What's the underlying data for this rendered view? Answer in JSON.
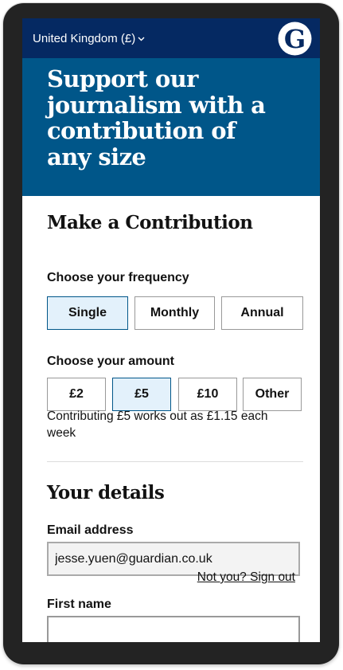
{
  "header": {
    "region_label": "United Kingdom (£)",
    "logo_letter": "G",
    "brand_color": "#052962"
  },
  "hero": {
    "title": "Support our journalism with a contribution of any size",
    "background": "#005689"
  },
  "contribution": {
    "heading": "Make a Contribution",
    "frequency": {
      "label": "Choose your frequency",
      "options": [
        "Single",
        "Monthly",
        "Annual"
      ],
      "selected": "Single"
    },
    "amount": {
      "label": "Choose your amount",
      "options": [
        "£2",
        "£5",
        "£10",
        "Other"
      ],
      "selected": "£5"
    },
    "summary": "Contributing £5 works out as £1.15 each week"
  },
  "details": {
    "heading": "Your details",
    "email_label": "Email address",
    "email_value": "jesse.yuen@guardian.co.uk",
    "signout_link": "Not you? Sign out",
    "first_name_label": "First name",
    "first_name_value": ""
  }
}
